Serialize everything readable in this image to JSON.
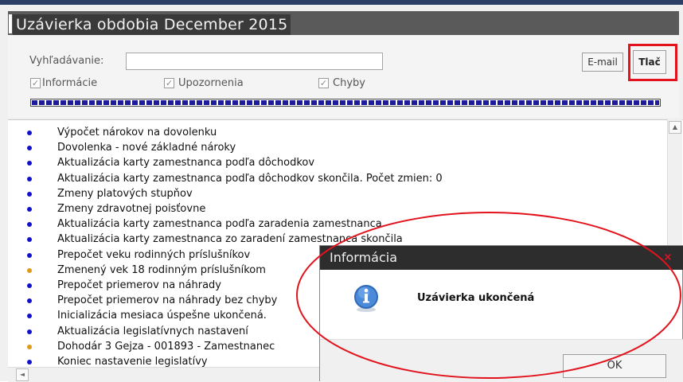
{
  "window": {
    "title": "Uzávierka obdobia December 2015",
    "search_label": "Vyhľadávanie:",
    "search_value": "",
    "email_button": "E-mail",
    "print_button": "Tlač",
    "filters": [
      {
        "label": "Informácie",
        "checked": true
      },
      {
        "label": "Upozornenia",
        "checked": true
      },
      {
        "label": "Chyby",
        "checked": true
      }
    ],
    "progress": 1.0
  },
  "log": {
    "items": [
      {
        "text": "Výpočet nárokov na dovolenku",
        "color": "#1111cc"
      },
      {
        "text": "Dovolenka - nové základné nároky",
        "color": "#1111cc"
      },
      {
        "text": "Aktualizácia karty zamestnanca podľa dôchodkov",
        "color": "#1111cc"
      },
      {
        "text": "Aktualizácia karty zamestnanca podľa dôchodkov skončila. Počet zmien: 0",
        "color": "#1111cc"
      },
      {
        "text": "Zmeny platových stupňov",
        "color": "#1111cc"
      },
      {
        "text": "Zmeny zdravotnej poisťovne",
        "color": "#1111cc"
      },
      {
        "text": "Aktualizácia karty zamestnanca podľa zaradenia zamestnanca",
        "color": "#1111cc"
      },
      {
        "text": "Aktualizácia karty zamestnanca zo zaradení zamestnanca skončila",
        "color": "#1111cc"
      },
      {
        "text": "Prepočet veku rodinných príslušníkov",
        "color": "#1111cc"
      },
      {
        "text": "Zmenený vek 18 rodinným príslušníkom",
        "color": "#e09a1a"
      },
      {
        "text": "Prepočet priemerov na náhrady",
        "color": "#1111cc"
      },
      {
        "text": "Prepočet priemerov na náhrady bez chyby",
        "color": "#1111cc"
      },
      {
        "text": "Inicializácia mesiaca úspešne ukončená.",
        "color": "#1111cc"
      },
      {
        "text": "Aktualizácia legislatívnych nastavení",
        "color": "#1111cc"
      },
      {
        "text": "Dohodár 3 Gejza - 001893 - Zamestnanec",
        "color": "#e09a1a"
      },
      {
        "text": "Koniec nastavenie legislatívy",
        "color": "#1111cc"
      }
    ]
  },
  "dialog": {
    "title": "Informácia",
    "message": "Uzávierka ukončená",
    "ok_button": "OK",
    "close_glyph": "×",
    "icon": "info-icon"
  },
  "scroll": {
    "up_glyph": "▲",
    "left_glyph": "◄"
  },
  "colors": {
    "highlight_red": "#e2131d",
    "info_bullet": "#1111cc",
    "warning_bullet": "#e09a1a",
    "dialog_title_bg": "#2d2d2d"
  }
}
